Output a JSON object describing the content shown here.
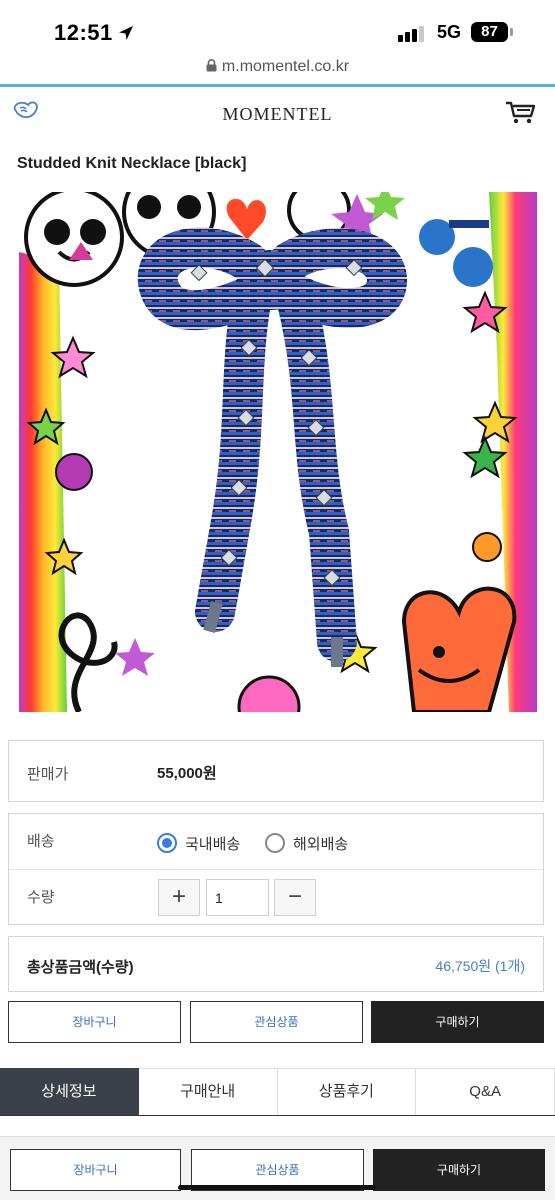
{
  "status_bar": {
    "time": "12:51",
    "network": "5G",
    "battery": "87"
  },
  "browser": {
    "url": "m.momentel.co.kr"
  },
  "header": {
    "brand": "MOMENTEL"
  },
  "product": {
    "title": "Studded Knit Necklace [black]",
    "price_label": "판매가",
    "price": "55,000원"
  },
  "options": {
    "shipping_label": "배송",
    "domestic_label": "국내배송",
    "overseas_label": "해외배송",
    "selected_shipping": "국내배송",
    "quantity_label": "수량",
    "quantity_value": "1",
    "plus_symbol": "+",
    "minus_symbol": "−"
  },
  "total": {
    "label": "총상품금액(수량)",
    "value": "46,750원 (1개)"
  },
  "actions": {
    "cart": "장바구니",
    "wishlist": "관심상품",
    "buy": "구매하기"
  },
  "tabs": [
    {
      "label": "상세정보",
      "active": true
    },
    {
      "label": "구매안내",
      "active": false
    },
    {
      "label": "상품후기",
      "active": false
    },
    {
      "label": "Q&A",
      "active": false
    }
  ],
  "colors": {
    "accent_blue": "#3a7be0",
    "link_blue": "#4a7fc1",
    "dark": "#222222",
    "tab_active": "#3c4049"
  }
}
